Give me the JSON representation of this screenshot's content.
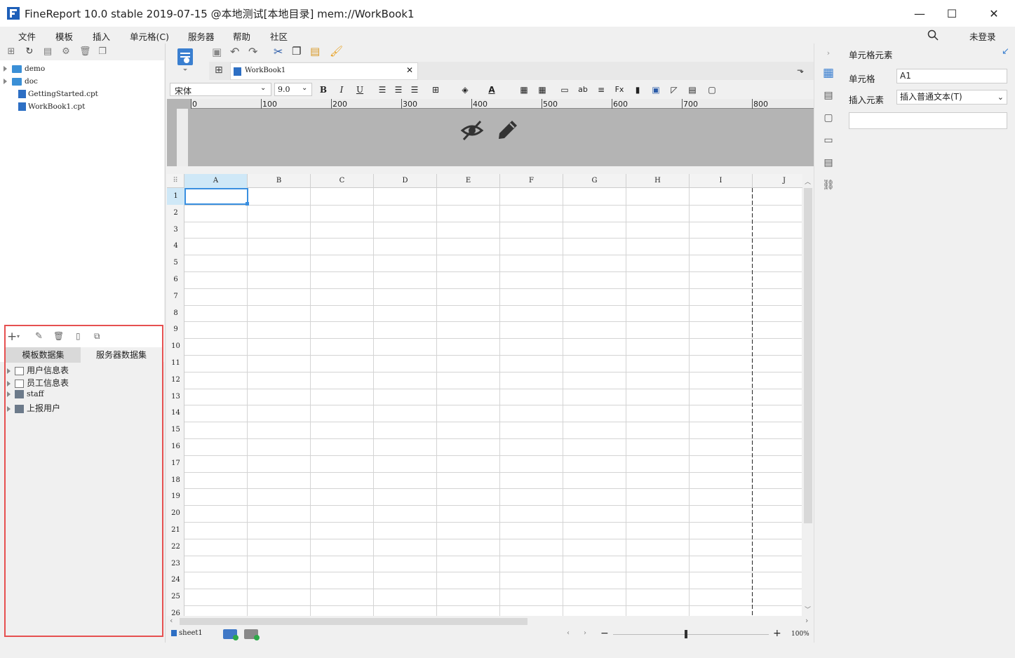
{
  "app": {
    "title": "FineReport 10.0 stable 2019-07-15 @本地测试[本地目录]    mem://WorkBook1"
  },
  "menu": [
    "文件",
    "模板",
    "插入",
    "单元格(C)",
    "服务器",
    "帮助",
    "社区"
  ],
  "user": {
    "label": "未登录"
  },
  "file_tree": [
    {
      "label": "demo",
      "type": "folder"
    },
    {
      "label": "doc",
      "type": "folder"
    },
    {
      "label": "GettingStarted.cpt",
      "type": "file"
    },
    {
      "label": "WorkBook1.cpt",
      "type": "file"
    }
  ],
  "datasets": {
    "tabs": [
      "模板数据集",
      "服务器数据集"
    ],
    "items": [
      {
        "label": "用户信息表",
        "icon": "table-icon"
      },
      {
        "label": "员工信息表",
        "icon": "table-icon"
      },
      {
        "label": "staff",
        "icon": "db-icon"
      },
      {
        "label": "上报用户",
        "icon": "db-icon"
      }
    ]
  },
  "doc_tab": {
    "label": "WorkBook1"
  },
  "format": {
    "font": "宋体",
    "size": "9.0"
  },
  "ruler": {
    "marks": [
      "0",
      "100",
      "200",
      "300",
      "400",
      "500",
      "600",
      "700",
      "800"
    ]
  },
  "columns": [
    "A",
    "B",
    "C",
    "D",
    "E",
    "F",
    "G",
    "H",
    "I",
    "J"
  ],
  "rows": [
    "1",
    "2",
    "3",
    "4",
    "5",
    "6",
    "7",
    "8",
    "9",
    "10",
    "11",
    "12",
    "13",
    "14",
    "15",
    "16",
    "17",
    "18",
    "19",
    "20",
    "21",
    "22",
    "23",
    "24",
    "25",
    "26"
  ],
  "sheet_tab": {
    "label": "sheet1"
  },
  "zoom": {
    "label": "100%"
  },
  "right_panel": {
    "title": "单元格元素",
    "cell_label": "单元格",
    "cell_value": "A1",
    "insert_label": "插入元素",
    "insert_value": "插入普通文本(T)"
  }
}
